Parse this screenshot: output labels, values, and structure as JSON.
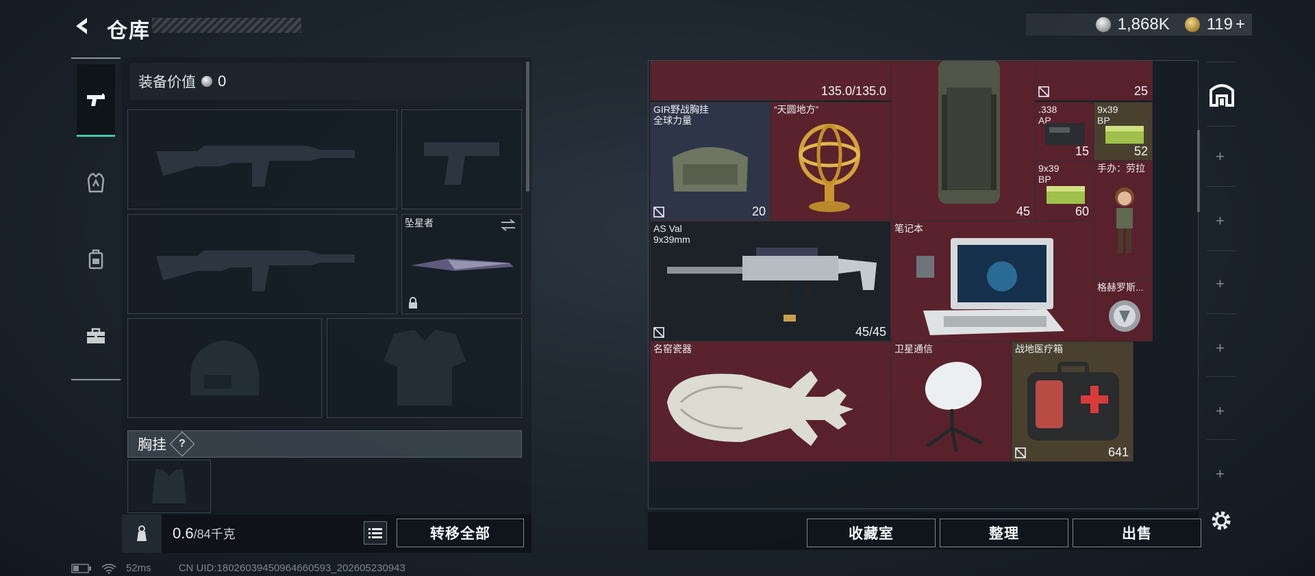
{
  "header": {
    "title": "仓库",
    "currencies": [
      {
        "icon": "silver-coin-icon",
        "value": "1,868K"
      },
      {
        "icon": "gold-coin-icon",
        "value": "119",
        "suffix": "+"
      }
    ]
  },
  "loadout": {
    "equip_value_label": "装备价值",
    "equip_value": "0",
    "melee_slot_label": "坠星者",
    "chest_rig_label": "胸挂",
    "help_symbol": "?",
    "weight_current": "0.6",
    "weight_capacity": "/84千克",
    "transfer_all_label": "转移全部"
  },
  "inventory": {
    "items": [
      {
        "name": "",
        "count": "135.0/135.0"
      },
      {
        "name": "",
        "count": "25"
      },
      {
        "name": "GIR野战胸挂\n全球力量",
        "count": "20"
      },
      {
        "name": "“天圆地方”",
        "count": ""
      },
      {
        "name": "",
        "count": "45"
      },
      {
        "name": ".338\nAP",
        "count": "15"
      },
      {
        "name": "9x39\nBP",
        "count": "52"
      },
      {
        "name": "9x39\nBP",
        "count": "60"
      },
      {
        "name": "手办：劳拉",
        "count": ""
      },
      {
        "name": "AS Val\n9x39mm",
        "count": "45/45"
      },
      {
        "name": "笔记本",
        "count": ""
      },
      {
        "name": "格赫罗斯...",
        "count": ""
      },
      {
        "name": "名窑瓷器",
        "count": ""
      },
      {
        "name": "卫星通信",
        "count": ""
      },
      {
        "name": "战地医疗箱",
        "count": "641"
      }
    ],
    "buttons": {
      "collection": "收藏室",
      "organize": "整理",
      "sell": "出售"
    }
  },
  "status": {
    "ping": "52ms",
    "uid": "CN UID:18026039450964660593_202605230943"
  },
  "colors": {
    "accent": "#3fc9a7",
    "cell_red": "#6c222e",
    "cell_blue": "#32384e"
  }
}
